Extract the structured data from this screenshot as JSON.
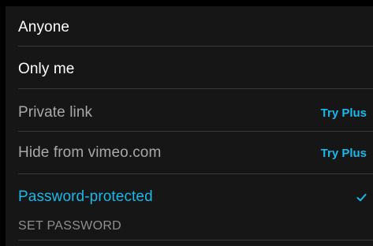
{
  "colors": {
    "background": "#000000",
    "list_background": "#161616",
    "primary_text": "#ffffff",
    "disabled_text": "#a8a8ad",
    "accent": "#1ab7ea",
    "secondary_text": "#8e8e93",
    "divider": "#3a3a3c"
  },
  "privacy": {
    "options": [
      {
        "label": "Anyone",
        "enabled": true
      },
      {
        "label": "Only me",
        "enabled": true
      },
      {
        "label": "Private link",
        "badge": "Try Plus",
        "enabled": false
      },
      {
        "label": "Hide from vimeo.com",
        "badge": "Try Plus",
        "enabled": false
      },
      {
        "label": "Password-protected",
        "selected": true,
        "enabled": true,
        "check_icon": "checkmark-icon"
      }
    ],
    "password_action": "SET PASSWORD"
  }
}
